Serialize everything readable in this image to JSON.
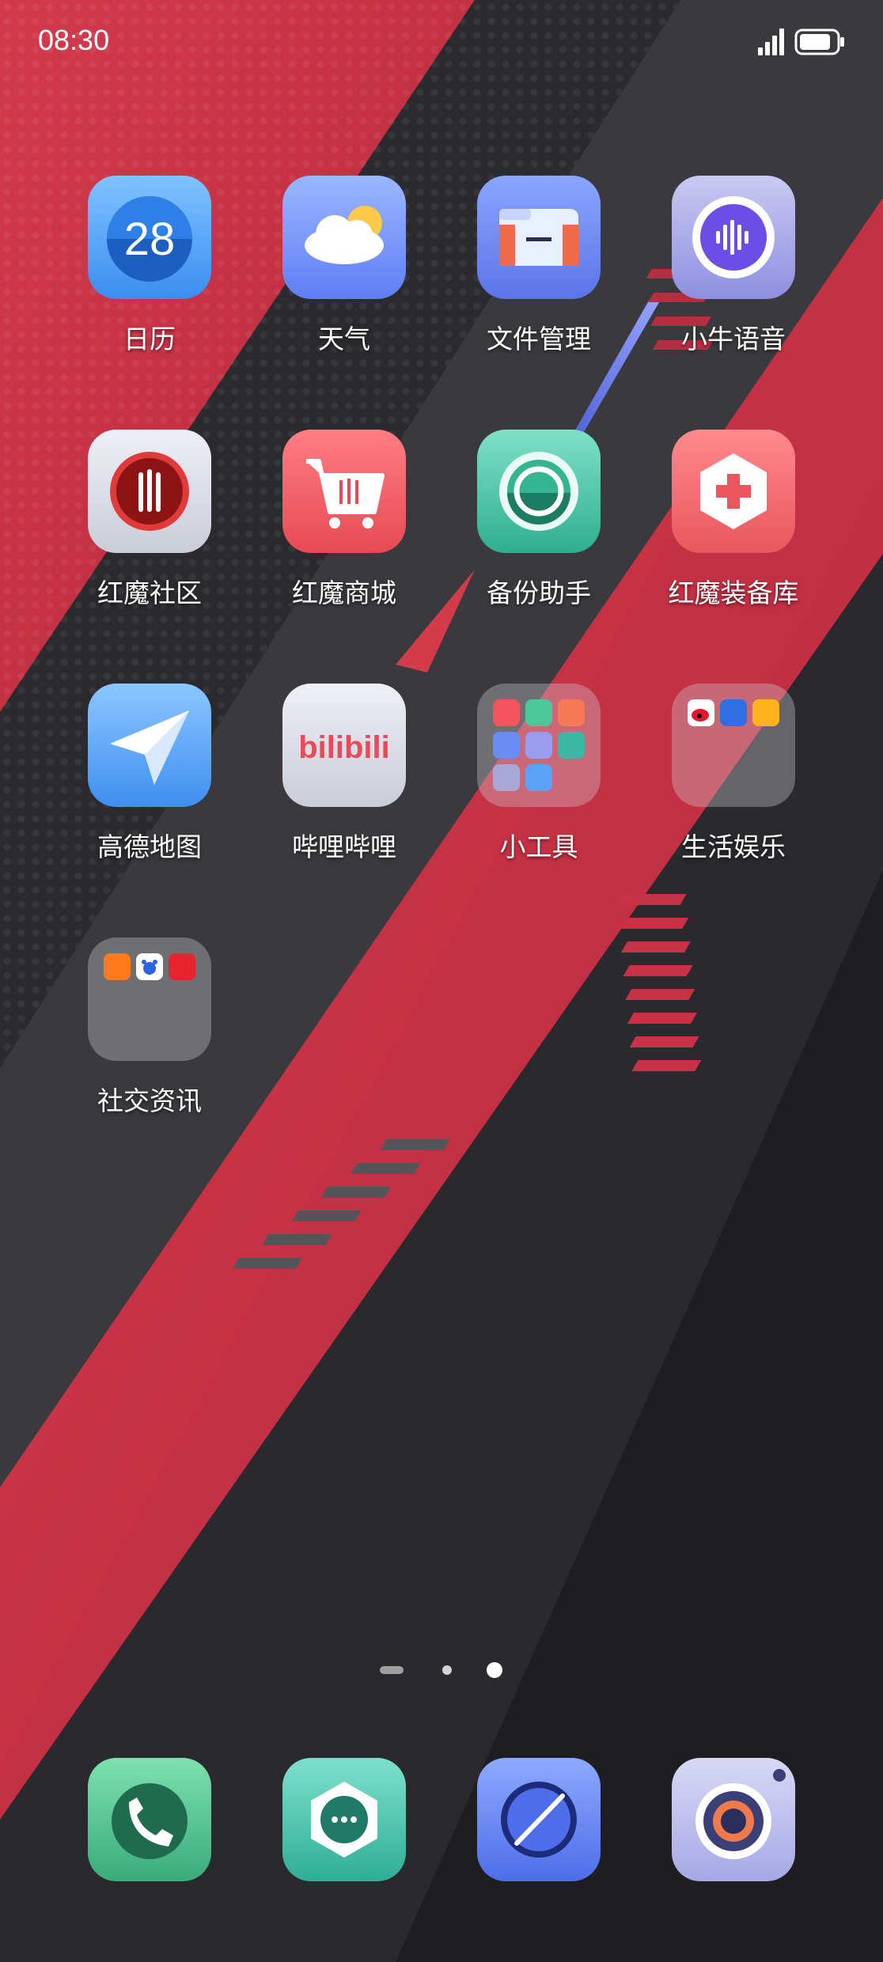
{
  "status_bar": {
    "time": "08:30"
  },
  "home": {
    "apps": [
      {
        "label": "日历",
        "day": "28"
      },
      {
        "label": "天气"
      },
      {
        "label": "文件管理"
      },
      {
        "label": "小牛语音"
      },
      {
        "label": "红魔社区"
      },
      {
        "label": "红魔商城"
      },
      {
        "label": "备份助手"
      },
      {
        "label": "红魔装备库"
      },
      {
        "label": "高德地图"
      },
      {
        "label": "哔哩哔哩",
        "logo_text": "bilibili"
      },
      {
        "label": "小工具"
      },
      {
        "label": "生活娱乐"
      },
      {
        "label": "社交资讯"
      }
    ]
  },
  "page_indicator": {
    "pages": 3,
    "current": 3
  },
  "dock": {
    "apps": [
      {
        "icon": "phone-icon"
      },
      {
        "icon": "messages-icon"
      },
      {
        "icon": "browser-icon"
      },
      {
        "icon": "camera-icon"
      }
    ]
  },
  "colors": {
    "accent_red": "#c93246",
    "wallpaper_dark": "#222226"
  }
}
